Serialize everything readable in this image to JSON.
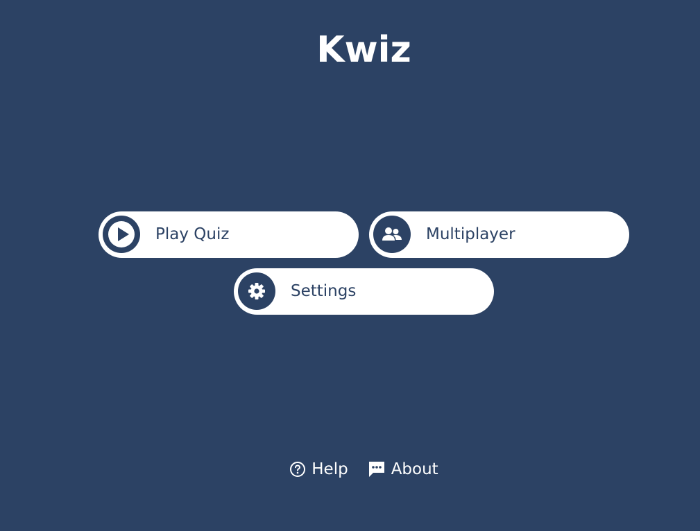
{
  "app": {
    "title": "Kwiz"
  },
  "menu": {
    "play": {
      "label": "Play Quiz",
      "icon": "play-icon"
    },
    "multiplayer": {
      "label": "Multiplayer",
      "icon": "users-icon"
    },
    "settings": {
      "label": "Settings",
      "icon": "gear-icon"
    }
  },
  "footer": {
    "help": {
      "label": "Help",
      "icon": "help-circle-icon"
    },
    "about": {
      "label": "About",
      "icon": "chat-icon"
    }
  },
  "colors": {
    "background": "#2c4264",
    "button": "#ffffff",
    "text_dark": "#2c4264",
    "text_light": "#ffffff"
  }
}
